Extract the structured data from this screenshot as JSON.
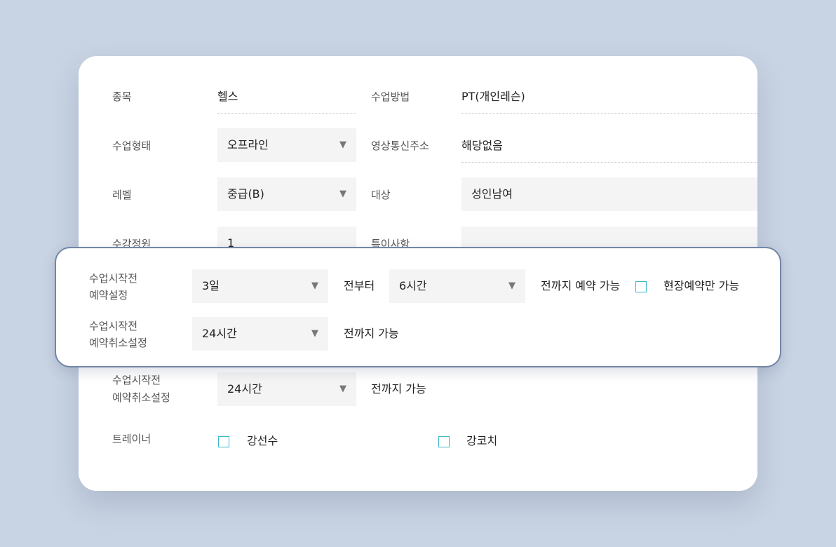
{
  "form": {
    "subject": {
      "label": "종목",
      "value": "헬스"
    },
    "method": {
      "label": "수업방법",
      "value": "PT(개인레슨)"
    },
    "type": {
      "label": "수업형태",
      "value": "오프라인"
    },
    "video_address": {
      "label": "영상통신주소",
      "value": "해당없음"
    },
    "level": {
      "label": "레벨",
      "value": "중급(B)"
    },
    "target": {
      "label": "대상",
      "value": "성인남여"
    },
    "capacity": {
      "label": "수강정원",
      "value": "1"
    },
    "notes": {
      "label": "특이사항",
      "value": ""
    },
    "cancel_setting_bg": {
      "label_line1": "수업시작전",
      "label_line2": "예약취소설정",
      "value": "24시간",
      "suffix": "전까지 가능"
    },
    "trainer": {
      "label": "트레이너",
      "options": [
        {
          "name": "강선수",
          "checked": false
        },
        {
          "name": "강코치",
          "checked": false
        }
      ]
    }
  },
  "overlay": {
    "reservation": {
      "label_line1": "수업시작전",
      "label_line2": "예약설정",
      "from_value": "3일",
      "from_suffix": "전부터",
      "until_value": "6시간",
      "until_suffix": "전까지 예약 가능",
      "onsite_label": "현장예약만 가능",
      "onsite_checked": false
    },
    "cancel": {
      "label_line1": "수업시작전",
      "label_line2": "예약취소설정",
      "value": "24시간",
      "suffix": "전까지 가능"
    }
  },
  "icons": {
    "dropdown": "triangle-down-icon",
    "checkbox": "checkbox-icon"
  },
  "colors": {
    "background": "#c8d3e3",
    "accent_checkbox": "#3eb6c8",
    "overlay_border": "#7286a7"
  }
}
